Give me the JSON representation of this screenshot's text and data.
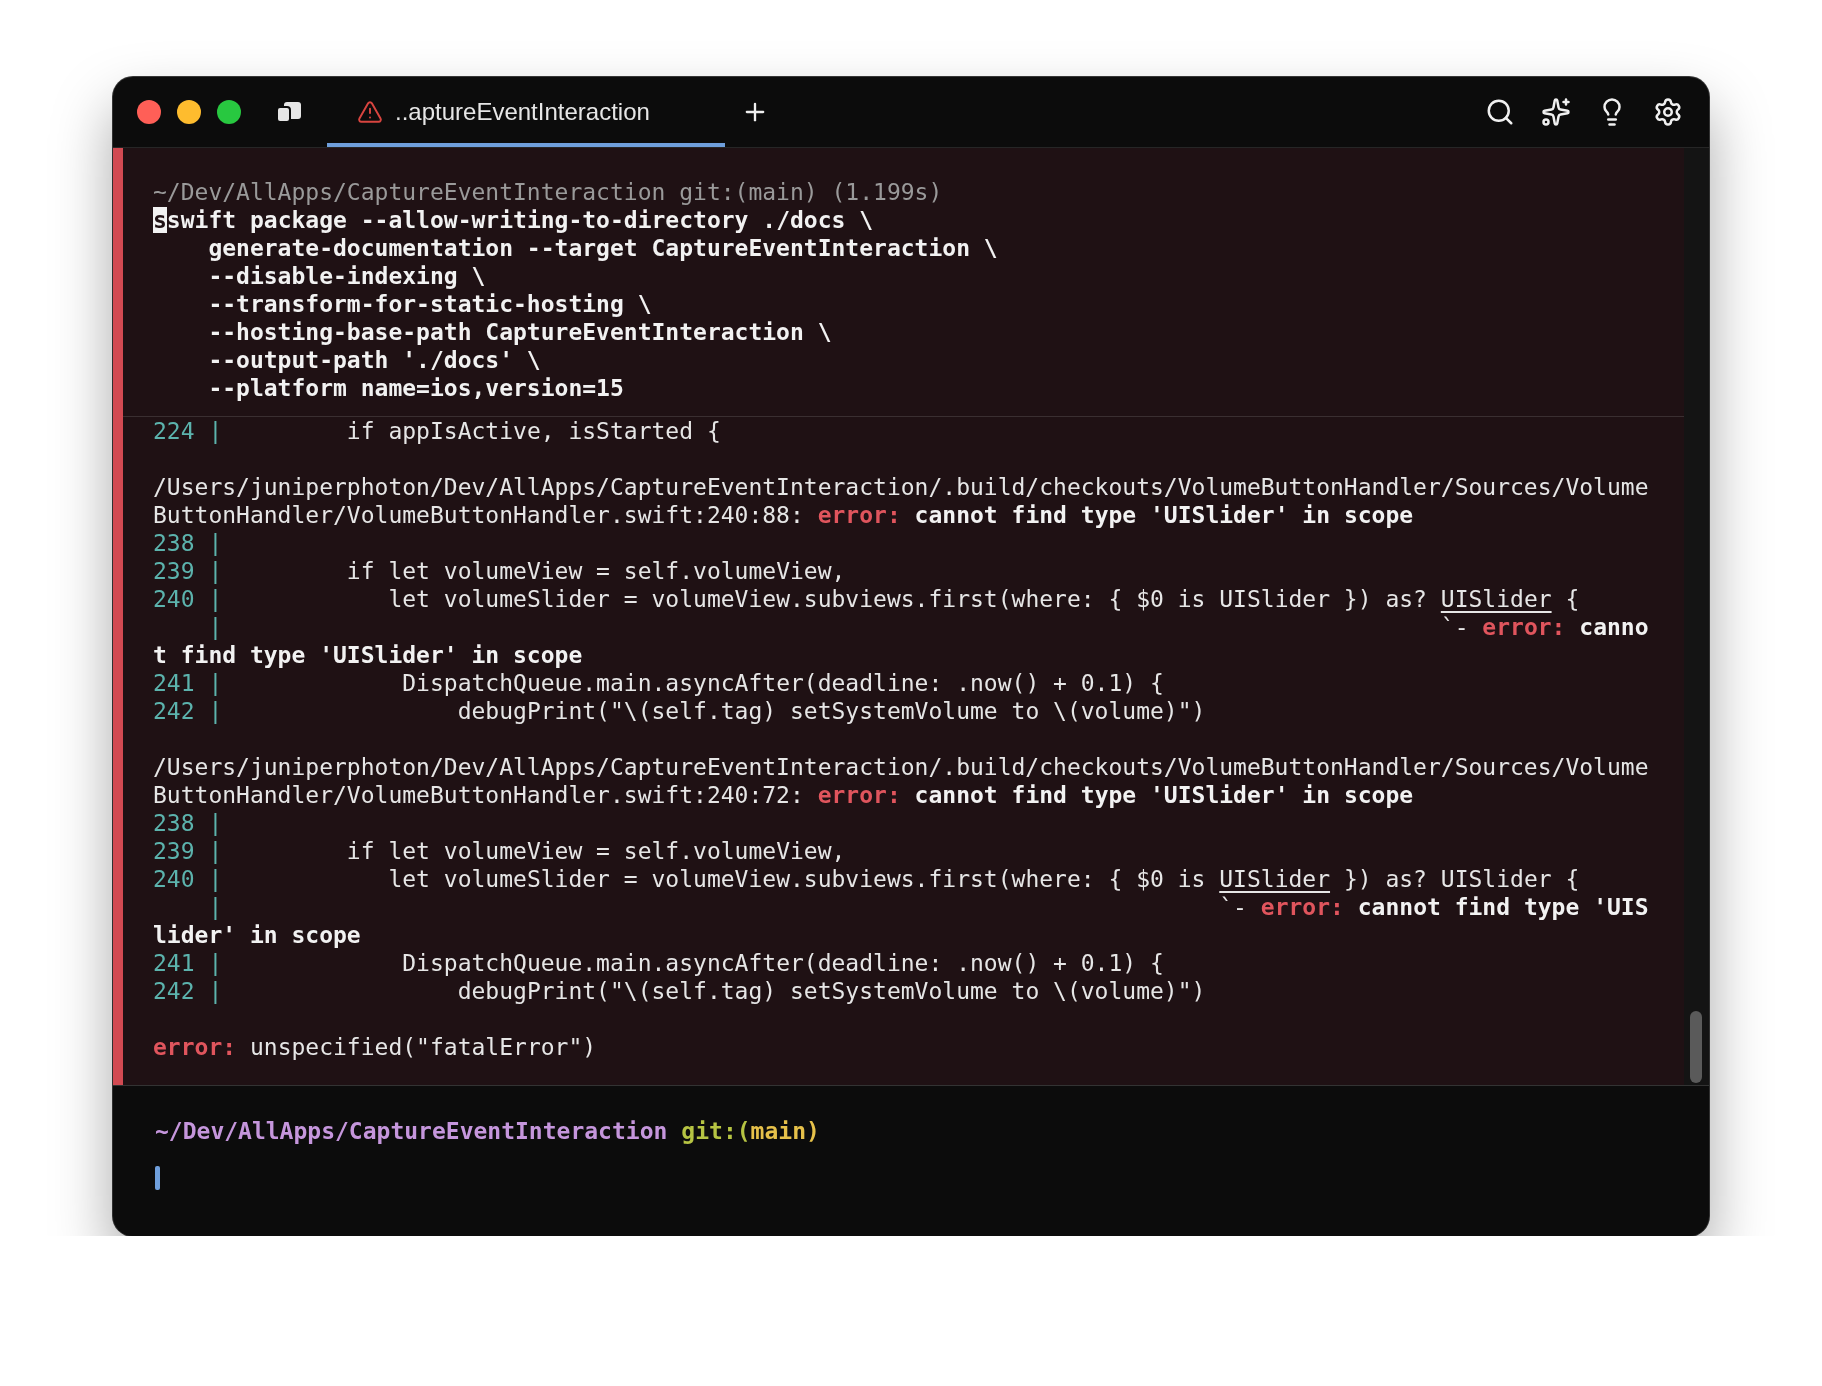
{
  "tabs": [
    {
      "label": "..aptureEventInteraction",
      "selected": true,
      "failed": true
    }
  ],
  "block": {
    "failed": true,
    "header": "~/Dev/AllApps/CaptureEventInteraction git:(main) (1.199s)",
    "command": {
      "cursor_char": "s",
      "lines": [
        "swift package --allow-writing-to-directory ./docs \\",
        "    generate-documentation --target CaptureEventInteraction \\",
        "    --disable-indexing \\",
        "    --transform-for-static-hosting \\",
        "    --hosting-base-path CaptureEventInteraction \\",
        "    --output-path './docs' \\",
        "    --platform name=ios,version=15"
      ]
    },
    "output": [
      {
        "kind": "code",
        "parts": [
          {
            "kind": "num",
            "text": "224 |"
          },
          {
            "kind": "plain",
            "text": "         if appIsActive, isStarted {"
          }
        ]
      },
      {
        "kind": "blank"
      },
      {
        "kind": "code",
        "parts": [
          {
            "kind": "plain",
            "text": "/Users/juniperphoton/Dev/AllApps/CaptureEventInteraction/.build/checkouts/VolumeButtonHandler/Sources/Volume"
          }
        ]
      },
      {
        "kind": "code",
        "parts": [
          {
            "kind": "plain",
            "text": "ButtonHandler/VolumeButtonHandler.swift:240:88: "
          },
          {
            "kind": "error",
            "text": "error:"
          },
          {
            "kind": "bold",
            "text": " cannot find type 'UISlider' in scope"
          }
        ]
      },
      {
        "kind": "code",
        "parts": [
          {
            "kind": "num",
            "text": "238 |"
          }
        ]
      },
      {
        "kind": "code",
        "parts": [
          {
            "kind": "num",
            "text": "239 |"
          },
          {
            "kind": "plain",
            "text": "         if let volumeView = self.volumeView,"
          }
        ]
      },
      {
        "kind": "code",
        "parts": [
          {
            "kind": "num",
            "text": "240 |"
          },
          {
            "kind": "plain",
            "text": "            let volumeSlider = volumeView.subviews.first(where: { $0 is UISlider }) as? "
          },
          {
            "kind": "under",
            "text": "UISlider"
          },
          {
            "kind": "plain",
            "text": " {"
          }
        ]
      },
      {
        "kind": "code",
        "parts": [
          {
            "kind": "num",
            "text": "    |"
          },
          {
            "kind": "plain",
            "text": "                                                                                        `- "
          },
          {
            "kind": "error",
            "text": "error:"
          },
          {
            "kind": "bold",
            "text": " canno"
          }
        ]
      },
      {
        "kind": "code",
        "parts": [
          {
            "kind": "bold",
            "text": "t find type 'UISlider' in scope"
          }
        ]
      },
      {
        "kind": "code",
        "parts": [
          {
            "kind": "num",
            "text": "241 |"
          },
          {
            "kind": "plain",
            "text": "             DispatchQueue.main.asyncAfter(deadline: .now() + 0.1) {"
          }
        ]
      },
      {
        "kind": "code",
        "parts": [
          {
            "kind": "num",
            "text": "242 |"
          },
          {
            "kind": "plain",
            "text": "                 debugPrint(\"\\(self.tag) setSystemVolume to \\(volume)\")"
          }
        ]
      },
      {
        "kind": "blank"
      },
      {
        "kind": "code",
        "parts": [
          {
            "kind": "plain",
            "text": "/Users/juniperphoton/Dev/AllApps/CaptureEventInteraction/.build/checkouts/VolumeButtonHandler/Sources/Volume"
          }
        ]
      },
      {
        "kind": "code",
        "parts": [
          {
            "kind": "plain",
            "text": "ButtonHandler/VolumeButtonHandler.swift:240:72: "
          },
          {
            "kind": "error",
            "text": "error:"
          },
          {
            "kind": "bold",
            "text": " cannot find type 'UISlider' in scope"
          }
        ]
      },
      {
        "kind": "code",
        "parts": [
          {
            "kind": "num",
            "text": "238 |"
          }
        ]
      },
      {
        "kind": "code",
        "parts": [
          {
            "kind": "num",
            "text": "239 |"
          },
          {
            "kind": "plain",
            "text": "         if let volumeView = self.volumeView,"
          }
        ]
      },
      {
        "kind": "code",
        "parts": [
          {
            "kind": "num",
            "text": "240 |"
          },
          {
            "kind": "plain",
            "text": "            let volumeSlider = volumeView.subviews.first(where: { $0 is "
          },
          {
            "kind": "under",
            "text": "UISlider"
          },
          {
            "kind": "plain",
            "text": " }) as? UISlider {"
          }
        ]
      },
      {
        "kind": "code",
        "parts": [
          {
            "kind": "num",
            "text": "    |"
          },
          {
            "kind": "plain",
            "text": "                                                                        `- "
          },
          {
            "kind": "error",
            "text": "error:"
          },
          {
            "kind": "bold",
            "text": " cannot find type 'UIS"
          }
        ]
      },
      {
        "kind": "code",
        "parts": [
          {
            "kind": "bold",
            "text": "lider' in scope"
          }
        ]
      },
      {
        "kind": "code",
        "parts": [
          {
            "kind": "num",
            "text": "241 |"
          },
          {
            "kind": "plain",
            "text": "             DispatchQueue.main.asyncAfter(deadline: .now() + 0.1) {"
          }
        ]
      },
      {
        "kind": "code",
        "parts": [
          {
            "kind": "num",
            "text": "242 |"
          },
          {
            "kind": "plain",
            "text": "                 debugPrint(\"\\(self.tag) setSystemVolume to \\(volume)\")"
          }
        ]
      },
      {
        "kind": "blank"
      },
      {
        "kind": "code",
        "parts": [
          {
            "kind": "error",
            "text": "error:"
          },
          {
            "kind": "plain",
            "text": " unspecified(\"fatalError\")"
          }
        ]
      }
    ]
  },
  "prompt": {
    "path": "~/Dev/AllApps/CaptureEventInteraction",
    "git": "git:(",
    "branch": "main)"
  }
}
